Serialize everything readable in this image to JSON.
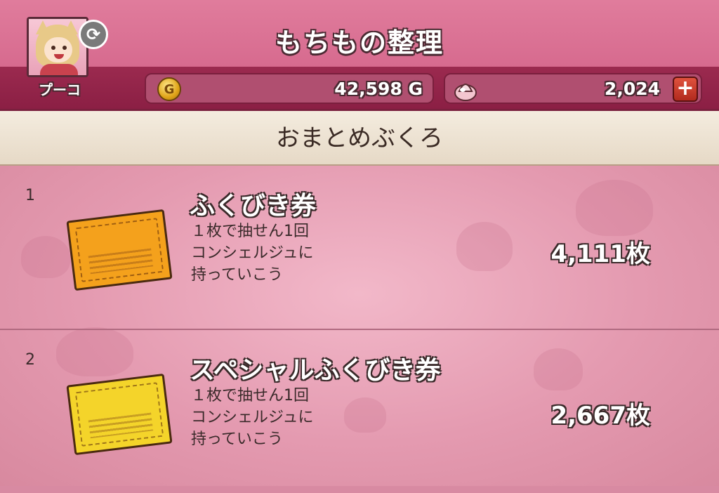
{
  "header": {
    "title": "もちもの整理",
    "player_name": "プーコ",
    "gold_value": "42,598 G",
    "gem_value": "2,024",
    "plus_label": "+",
    "refresh_label": "⟳",
    "coin_symbol": "G"
  },
  "section": {
    "title": "おまとめぶくろ"
  },
  "items": [
    {
      "index": "1",
      "name": "ふくびき券",
      "desc_line1": "１枚で抽せん1回",
      "desc_line2": "コンシェルジュに",
      "desc_line3": "持っていこう",
      "count": "4,111枚",
      "ticket_color": "#f4a11c",
      "ticket_icon": "fukubiki-ticket-icon"
    },
    {
      "index": "2",
      "name": "スペシャルふくびき券",
      "desc_line1": "１枚で抽せん1回",
      "desc_line2": "コンシェルジュに",
      "desc_line3": "持っていこう",
      "count": "2,667枚",
      "ticket_color": "#f4d42a",
      "ticket_icon": "special-fukubiki-ticket-icon"
    }
  ],
  "colors": {
    "header_pink": "#d76b8f",
    "header_strip": "#8b1f44",
    "list_bg": "#e49ab0",
    "plus_red": "#c8392a"
  }
}
